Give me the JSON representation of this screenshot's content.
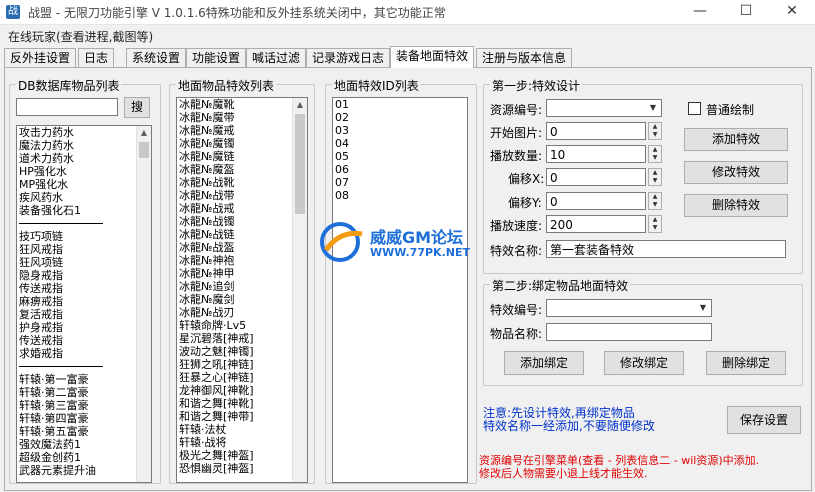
{
  "window": {
    "title": "战盟 - 无限刀功能引擎 V 1.0.1.6特殊功能和反外挂系统关闭中，其它功能正常",
    "status": "在线玩家(查看进程,截图等)"
  },
  "tabs": [
    "反外挂设置",
    "日志",
    "系统设置",
    "功能设置",
    "喊话过滤",
    "记录游戏日志",
    "装备地面特效",
    "注册与版本信息"
  ],
  "db_list": {
    "title": "DB数据库物品列表",
    "search_label": "搜",
    "search_value": "",
    "items": [
      "攻击力药水",
      "魔法力药水",
      "道术力药水",
      "HP强化水",
      "MP强化水",
      "疾风药水",
      "装备强化石1",
      "---",
      "技巧项链",
      "狂风戒指",
      "狂风项链",
      "隐身戒指",
      "传送戒指",
      "麻痹戒指",
      "复活戒指",
      "护身戒指",
      "传送戒指",
      "求婚戒指",
      "---",
      "轩辕·第一富豪",
      "轩辕·第二富豪",
      "轩辕·第三富豪",
      "轩辕·第四富豪",
      "轩辕·第五富豪",
      "强效魔法药1",
      "超级金创药1",
      "武器元素提升油"
    ]
  },
  "ground_list": {
    "title": "地面物品特效列表",
    "items": [
      "冰龍№魔靴",
      "冰龍№魔带",
      "冰龍№魔戒",
      "冰龍№魔镯",
      "冰龍№魔链",
      "冰龍№魔盔",
      "冰龍№战靴",
      "冰龍№战带",
      "冰龍№战戒",
      "冰龍№战镯",
      "冰龍№战链",
      "冰龍№战盔",
      "冰龍№神袍",
      "冰龍№神甲",
      "冰龍№追剑",
      "冰龍№魔剑",
      "冰龍№战刃",
      "轩辕命牌·Lv5",
      "星沉碧落[神戒]",
      "波动之魅[神镯]",
      "狂狮之吼[神链]",
      "狂暴之心[神链]",
      "龙神御风[神靴]",
      "和谐之舞[神靴]",
      "和谐之舞[神带]",
      "轩辕·法杖",
      "轩辕·战将",
      "极光之舞[神盔]",
      "恐惧幽灵[神盔]"
    ]
  },
  "fx_list": {
    "title": "地面特效ID列表",
    "items": [
      "01",
      "02",
      "03",
      "04",
      "05",
      "06",
      "07",
      "08"
    ]
  },
  "step1": {
    "title": "第一步:特效设计",
    "resource_label": "资源编号:",
    "resource_value": "",
    "normal_draw_label": "普通绘制",
    "start_frame_label": "开始图片:",
    "start_frame_value": "0",
    "frame_count_label": "播放数量:",
    "frame_count_value": "10",
    "offset_x_label": "偏移X:",
    "offset_x_value": "0",
    "offset_y_label": "偏移Y:",
    "offset_y_value": "0",
    "speed_label": "播放速度:",
    "speed_value": "200",
    "name_label": "特效名称:",
    "name_value": "第一套装备特效",
    "add_btn": "添加特效",
    "edit_btn": "修改特效",
    "delete_btn": "删除特效"
  },
  "step2": {
    "title": "第二步:绑定物品地面特效",
    "fx_id_label": "特效编号:",
    "fx_id_value": "",
    "item_name_label": "物品名称:",
    "item_name_value": "",
    "add_btn": "添加绑定",
    "edit_btn": "修改绑定",
    "delete_btn": "删除绑定"
  },
  "notes": {
    "note1": "注意:先设计特效,再绑定物品",
    "note2": "特效名称一经添加,不要随便修改",
    "save_btn": "保存设置",
    "warn1": "资源编号在引擎菜单(查看 - 列表信息二 - wil资源)中添加.",
    "warn2": "修改后人物需要小退上线才能生效."
  },
  "watermark": {
    "text": "威威GM论坛",
    "url": "WWW.77PK.NET"
  },
  "colors": {
    "note_blue": "#0033cc",
    "warn_red": "#e00000",
    "watermark_blue": "#1e6fd9",
    "watermark_orange": "#f39c12"
  }
}
